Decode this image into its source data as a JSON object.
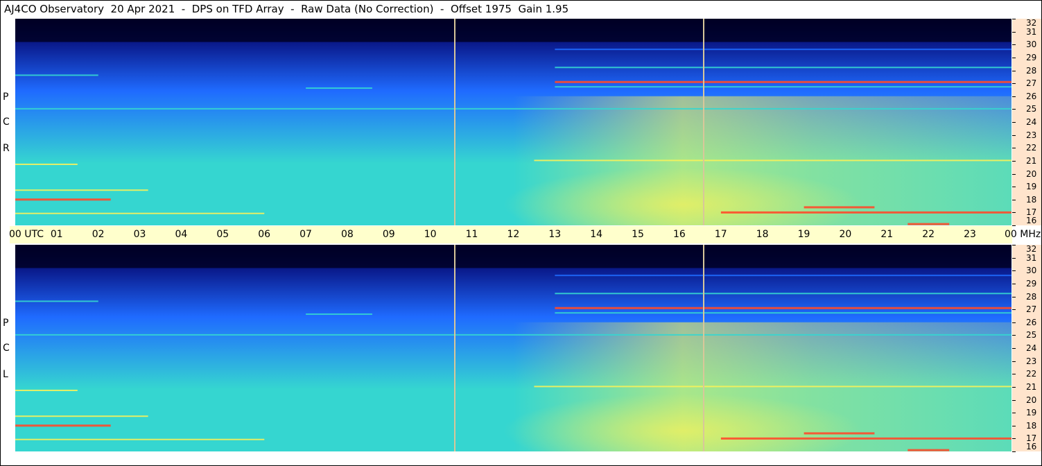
{
  "title": "AJ4CO Observatory  20 Apr 2021  -  DPS on TFD Array  -  Raw Data (No Correction)  -  Offset 1975  Gain 1.95",
  "colors": {
    "background": "#ffffff",
    "timebar": "#ffffcc",
    "freq_axis": "#ffe4cc",
    "marker": "#d8c79a",
    "low": "#000024",
    "mid": "#1f6bff",
    "high": "#35d6d0",
    "peak": "#f7f25a",
    "hot": "#ff4a2a"
  },
  "panels": [
    {
      "id": "top",
      "label_letters": [
        "R",
        "C",
        "P"
      ]
    },
    {
      "id": "bottom",
      "label_letters": [
        "L",
        "C",
        "P"
      ]
    }
  ],
  "time_axis": {
    "labels": [
      "00 UTC",
      "01",
      "02",
      "03",
      "04",
      "05",
      "06",
      "07",
      "08",
      "09",
      "10",
      "11",
      "12",
      "13",
      "14",
      "15",
      "16",
      "17",
      "18",
      "19",
      "20",
      "21",
      "22",
      "23",
      "00 MHz"
    ]
  },
  "freq_axis": {
    "labels": [
      "32",
      "31",
      "30",
      "29",
      "28",
      "27",
      "26",
      "25",
      "24",
      "23",
      "22",
      "21",
      "20",
      "19",
      "18",
      "17",
      "16"
    ]
  },
  "chart_data": {
    "type": "heatmap",
    "title": "AJ4CO Observatory  20 Apr 2021  -  DPS on TFD Array  -  Raw Data (No Correction)  -  Offset 1975  Gain 1.95",
    "x": {
      "label": "UTC",
      "ticks": [
        "00",
        "01",
        "02",
        "03",
        "04",
        "05",
        "06",
        "07",
        "08",
        "09",
        "10",
        "11",
        "12",
        "13",
        "14",
        "15",
        "16",
        "17",
        "18",
        "19",
        "20",
        "21",
        "22",
        "23",
        "00"
      ],
      "range": [
        0,
        24
      ]
    },
    "y": {
      "label": "MHz",
      "ticks": [
        32,
        31,
        30,
        29,
        28,
        27,
        26,
        25,
        24,
        23,
        22,
        21,
        20,
        19,
        18,
        17,
        16
      ],
      "range": [
        16,
        32
      ]
    },
    "panels": [
      {
        "polarization": "RCP"
      },
      {
        "polarization": "LCP"
      }
    ],
    "colormap": [
      "#000024",
      "#0a1a8c",
      "#1f6bff",
      "#35d6d0",
      "#f7f25a",
      "#ff4a2a"
    ],
    "markers_utc": [
      10.55,
      16.55
    ],
    "bands": [
      {
        "freq": 27.1,
        "start": 13.0,
        "end": 24.0,
        "level": "hot"
      },
      {
        "freq": 28.2,
        "start": 13.0,
        "end": 24.0,
        "level": "high"
      },
      {
        "freq": 26.7,
        "start": 13.0,
        "end": 24.0,
        "level": "high"
      },
      {
        "freq": 29.6,
        "start": 13.0,
        "end": 24.0,
        "level": "mid"
      },
      {
        "freq": 27.6,
        "start": 0.0,
        "end": 2.0,
        "level": "high"
      },
      {
        "freq": 26.6,
        "start": 7.0,
        "end": 8.6,
        "level": "high"
      },
      {
        "freq": 25.0,
        "start": 0.0,
        "end": 24.0,
        "level": "high"
      },
      {
        "freq": 21.0,
        "start": 12.5,
        "end": 24.0,
        "level": "peak"
      },
      {
        "freq": 20.7,
        "start": 0.0,
        "end": 1.5,
        "level": "peak"
      },
      {
        "freq": 18.7,
        "start": 0.0,
        "end": 3.2,
        "level": "peak"
      },
      {
        "freq": 18.0,
        "start": 0.0,
        "end": 2.3,
        "level": "hot"
      },
      {
        "freq": 17.4,
        "start": 19.0,
        "end": 20.7,
        "level": "hot"
      },
      {
        "freq": 17.0,
        "start": 17.0,
        "end": 24.0,
        "level": "hot"
      },
      {
        "freq": 16.9,
        "start": 0.0,
        "end": 6.0,
        "level": "peak"
      },
      {
        "freq": 16.1,
        "start": 21.5,
        "end": 22.5,
        "level": "hot"
      }
    ]
  }
}
